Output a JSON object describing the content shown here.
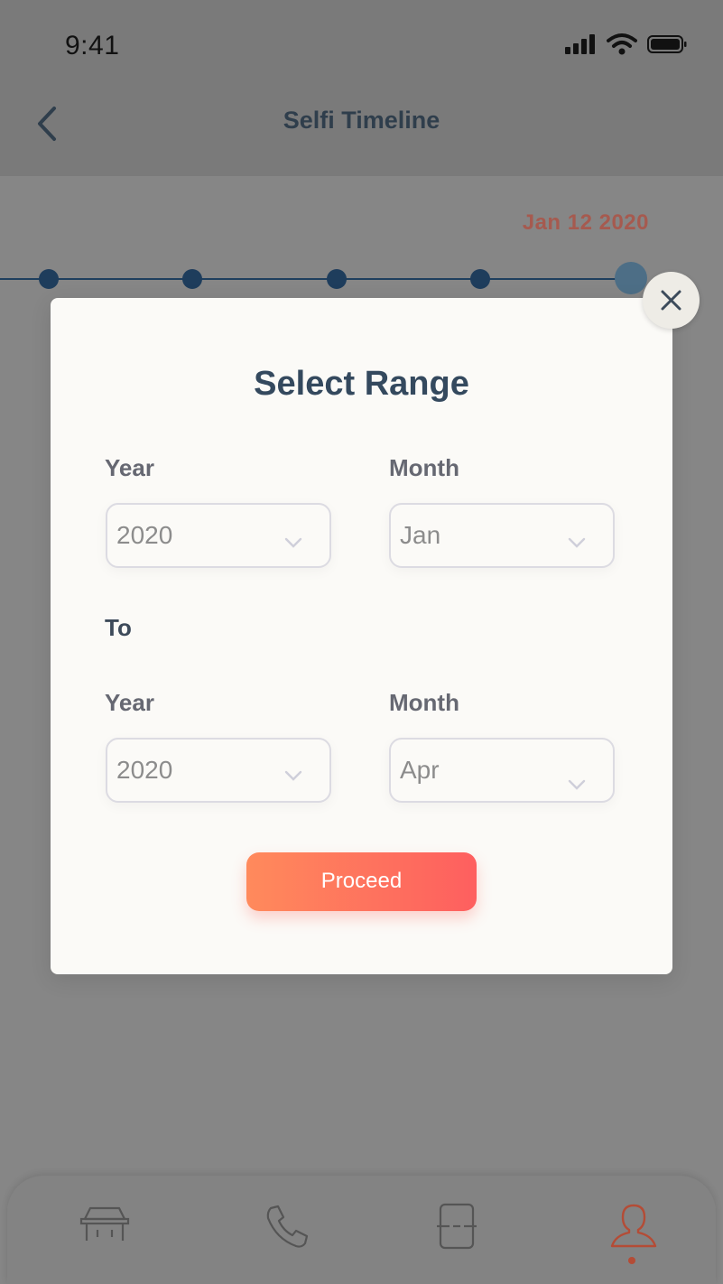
{
  "status_bar": {
    "time": "9:41"
  },
  "nav": {
    "title": "Selfi Timeline"
  },
  "timeline": {
    "current_date": "Jan 12 2020"
  },
  "modal": {
    "title": "Select Range",
    "from": {
      "year_label": "Year",
      "year_value": "2020",
      "month_label": "Month",
      "month_value": "Jan"
    },
    "to_label": "To",
    "to": {
      "year_label": "Year",
      "year_value": "2020",
      "month_label": "Month",
      "month_value": "Apr"
    },
    "proceed_label": "Proceed"
  },
  "tab_bar": {
    "items": [
      "home-table-icon",
      "phone-icon",
      "scan-icon",
      "profile-icon"
    ],
    "active": "profile-icon"
  },
  "colors": {
    "accent_start": "#ff8a5c",
    "accent_end": "#fe5f5f",
    "title_text": "#34495e",
    "timeline_dot": "#1e3d5c"
  }
}
